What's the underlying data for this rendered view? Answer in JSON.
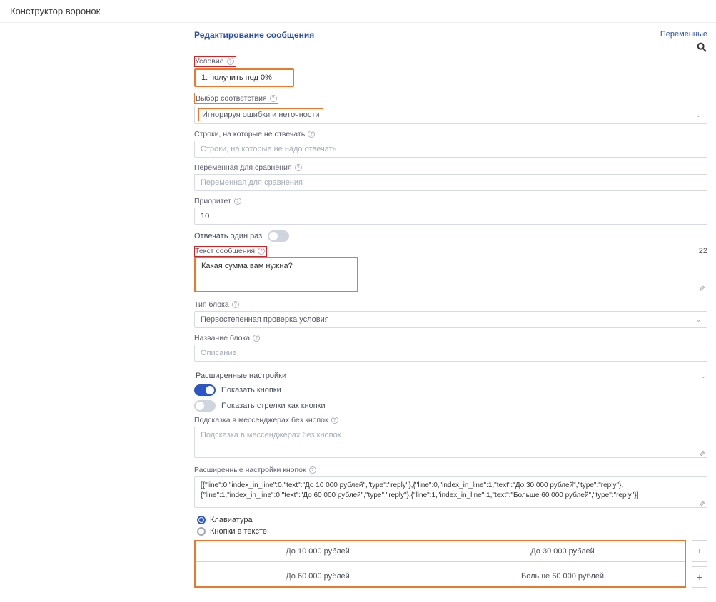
{
  "header": {
    "title": "Конструктор воронок"
  },
  "topRight": {
    "variables": "Переменные"
  },
  "panel": {
    "title": "Редактирование сообщения",
    "condition": {
      "label": "Условие",
      "value": "1: получить под 0%"
    },
    "match": {
      "label": "Выбор соответствия",
      "value": "Игнорируя ошибки и неточности"
    },
    "ignoreLines": {
      "label": "Строки, на которые не отвечать",
      "placeholder": "Строки, на которые не надо отвечать"
    },
    "compareVar": {
      "label": "Переменная для сравнения",
      "placeholder": "Переменная для сравнения"
    },
    "priority": {
      "label": "Приоритет",
      "value": "10"
    },
    "answerOnce": {
      "label": "Отвечать один раз"
    },
    "messageText": {
      "label": "Текст сообщения",
      "counter": "22",
      "value": "Какая сумма вам нужна?"
    },
    "blockType": {
      "label": "Тип блока",
      "value": "Первостепенная проверка условия"
    },
    "blockName": {
      "label": "Название блока",
      "placeholder": "Описание"
    },
    "advanced": {
      "label": "Расширенные настройки"
    },
    "showButtons": {
      "label": "Показать кнопки"
    },
    "showArrows": {
      "label": "Показать стрелки как кнопки"
    },
    "hintNoButtons": {
      "label": "Подсказка в мессенджерах без кнопок",
      "placeholder": "Подсказка в мессенджерах без кнопок"
    },
    "advButtons": {
      "label": "Расширенные настройки кнопок",
      "value": "[{\"line\":0,\"index_in_line\":0,\"text\":\"До 10 000 рублей\",\"type\":\"reply\"},{\"line\":0,\"index_in_line\":1,\"text\":\"До 30 000 рублей\",\"type\":\"reply\"},{\"line\":1,\"index_in_line\":0,\"text\":\"До 60 000 рублей\",\"type\":\"reply\"},{\"line\":1,\"index_in_line\":1,\"text\":\"Больше 60 000 рублей\",\"type\":\"reply\"}]"
    },
    "radios": {
      "keyboard": "Клавиатура",
      "inText": "Кнопки в тексте"
    },
    "kb": {
      "b1": "До 10 000 рублей",
      "b2": "До 30 000 рублей",
      "b3": "До 60 000 рублей",
      "b4": "Больше 60 000 рублей"
    },
    "plus": "+"
  }
}
